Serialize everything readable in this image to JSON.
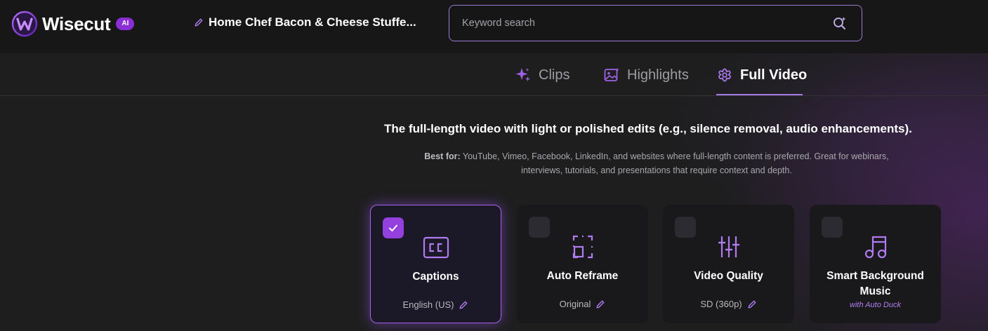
{
  "app": {
    "name": "Wisecut",
    "badge": "AI"
  },
  "project": {
    "title": "Home Chef Bacon & Cheese Stuffe..."
  },
  "search": {
    "placeholder": "Keyword search"
  },
  "tabs": [
    {
      "label": "Clips",
      "icon": "sparkles-icon",
      "active": false
    },
    {
      "label": "Highlights",
      "icon": "image-sparkle-icon",
      "active": false
    },
    {
      "label": "Full Video",
      "icon": "flower-gear-icon",
      "active": true
    }
  ],
  "content": {
    "headline": "The full-length video with light or polished edits (e.g., silence removal, audio enhancements).",
    "best_for_label": "Best for:",
    "best_for_text": "YouTube, Vimeo, Facebook, LinkedIn, and websites where full-length content is preferred. Great for webinars, interviews, tutorials, and presentations that require context and depth."
  },
  "options": [
    {
      "title": "Captions",
      "subtitle": "English (US)",
      "checked": true,
      "icon": "closed-captions-icon"
    },
    {
      "title": "Auto Reframe",
      "subtitle": "Original",
      "checked": false,
      "icon": "reframe-icon"
    },
    {
      "title": "Video Quality",
      "subtitle": "SD (360p)",
      "checked": false,
      "icon": "sliders-icon"
    },
    {
      "title": "Smart Background Music",
      "subtitle": "with Auto Duck",
      "checked": false,
      "icon": "music-note-icon"
    }
  ],
  "colors": {
    "accent": "#9340de",
    "accent_light": "#a47be0",
    "background": "#1e1e1f",
    "topbar": "#171718"
  }
}
